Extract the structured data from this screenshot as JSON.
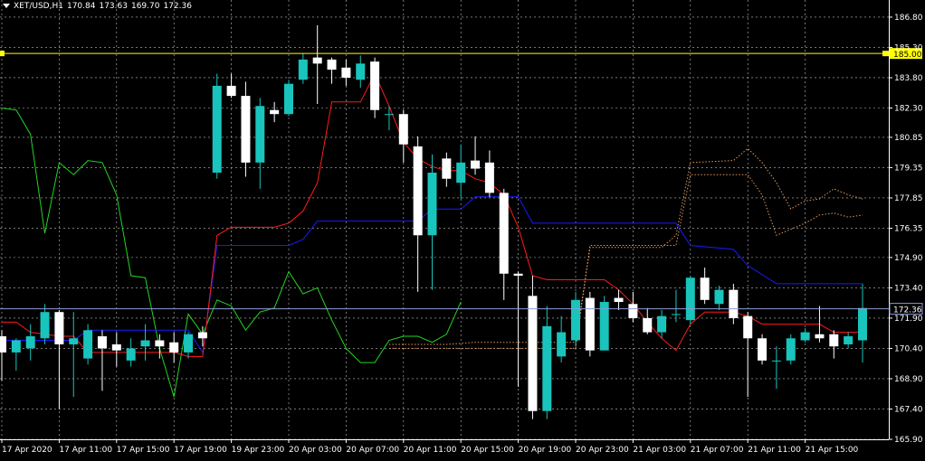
{
  "header": {
    "symbol": "XET/USD,H1",
    "open": "170.84",
    "high": "173.63",
    "low": "169.70",
    "close": "172.36"
  },
  "colors": {
    "background": "#000000",
    "grid": "#c0c0c0",
    "bull": "#19c4bd",
    "bear": "#ffffff",
    "tenkan": "#ff1a1a",
    "kijun": "#1a1aff",
    "chikou": "#22d422",
    "cloud": "#e0985a",
    "alert": "#ffff00",
    "price": "#8c9cd8"
  },
  "chart_data": {
    "type": "candlestick",
    "ylim": [
      165.9,
      187.2
    ],
    "y_ticks": [
      "186.80",
      "185.30",
      "183.80",
      "182.30",
      "180.85",
      "179.35",
      "177.85",
      "176.35",
      "174.90",
      "173.40",
      "171.90",
      "170.40",
      "168.90",
      "167.40",
      "165.90"
    ],
    "x_tick_labels": [
      "17 Apr 2020",
      "17 Apr 11:00",
      "17 Apr 15:00",
      "17 Apr 19:00",
      "19 Apr 23:00",
      "20 Apr 03:00",
      "20 Apr 07:00",
      "20 Apr 11:00",
      "20 Apr 15:00",
      "20 Apr 19:00",
      "20 Apr 23:00",
      "21 Apr 03:00",
      "21 Apr 07:00",
      "21 Apr 11:00",
      "21 Apr 15:00"
    ],
    "alert_level": "185.00",
    "current_price": "172.36",
    "candles": [
      {
        "o": 171.0,
        "h": 171.3,
        "l": 168.8,
        "c": 170.2
      },
      {
        "o": 170.2,
        "h": 170.9,
        "l": 169.3,
        "c": 170.8
      },
      {
        "o": 170.4,
        "h": 171.6,
        "l": 169.8,
        "c": 171.0
      },
      {
        "o": 170.9,
        "h": 172.6,
        "l": 170.6,
        "c": 172.2
      },
      {
        "o": 172.2,
        "h": 172.3,
        "l": 167.4,
        "c": 170.6
      },
      {
        "o": 170.6,
        "h": 172.2,
        "l": 168.0,
        "c": 170.9
      },
      {
        "o": 169.9,
        "h": 171.6,
        "l": 169.6,
        "c": 171.3
      },
      {
        "o": 171.0,
        "h": 171.3,
        "l": 168.3,
        "c": 170.4
      },
      {
        "o": 170.6,
        "h": 171.2,
        "l": 169.5,
        "c": 170.3
      },
      {
        "o": 169.8,
        "h": 170.9,
        "l": 169.5,
        "c": 170.4
      },
      {
        "o": 170.5,
        "h": 171.6,
        "l": 169.8,
        "c": 170.8
      },
      {
        "o": 170.8,
        "h": 171.1,
        "l": 169.9,
        "c": 170.5
      },
      {
        "o": 170.7,
        "h": 171.2,
        "l": 169.7,
        "c": 170.2
      },
      {
        "o": 170.2,
        "h": 171.2,
        "l": 169.9,
        "c": 171.1
      },
      {
        "o": 171.2,
        "h": 171.5,
        "l": 170.5,
        "c": 170.9
      },
      {
        "o": 179.1,
        "h": 184.0,
        "l": 178.8,
        "c": 183.4
      },
      {
        "o": 183.4,
        "h": 184.0,
        "l": 182.8,
        "c": 182.9
      },
      {
        "o": 182.9,
        "h": 183.6,
        "l": 178.9,
        "c": 179.6
      },
      {
        "o": 179.6,
        "h": 182.8,
        "l": 178.3,
        "c": 182.4
      },
      {
        "o": 182.2,
        "h": 182.6,
        "l": 181.6,
        "c": 182.0
      },
      {
        "o": 182.0,
        "h": 183.7,
        "l": 181.9,
        "c": 183.5
      },
      {
        "o": 183.7,
        "h": 185.0,
        "l": 183.5,
        "c": 184.7
      },
      {
        "o": 184.8,
        "h": 186.4,
        "l": 182.5,
        "c": 184.5
      },
      {
        "o": 184.7,
        "h": 184.8,
        "l": 183.5,
        "c": 184.2
      },
      {
        "o": 184.3,
        "h": 184.7,
        "l": 183.4,
        "c": 183.8
      },
      {
        "o": 183.7,
        "h": 184.9,
        "l": 183.3,
        "c": 184.5
      },
      {
        "o": 184.6,
        "h": 184.8,
        "l": 181.8,
        "c": 182.2
      },
      {
        "o": 182.0,
        "h": 182.4,
        "l": 181.2,
        "c": 182.0
      },
      {
        "o": 182.0,
        "h": 182.2,
        "l": 179.6,
        "c": 180.5
      },
      {
        "o": 180.4,
        "h": 180.9,
        "l": 173.2,
        "c": 176.0
      },
      {
        "o": 176.0,
        "h": 180.0,
        "l": 173.3,
        "c": 179.1
      },
      {
        "o": 179.8,
        "h": 180.1,
        "l": 178.4,
        "c": 178.8
      },
      {
        "o": 178.6,
        "h": 180.5,
        "l": 177.8,
        "c": 179.6
      },
      {
        "o": 179.7,
        "h": 180.9,
        "l": 179.0,
        "c": 179.3
      },
      {
        "o": 179.6,
        "h": 180.2,
        "l": 177.9,
        "c": 178.1
      },
      {
        "o": 178.1,
        "h": 178.3,
        "l": 172.8,
        "c": 174.1
      },
      {
        "o": 174.1,
        "h": 174.2,
        "l": 168.5,
        "c": 174.0
      },
      {
        "o": 173.0,
        "h": 174.0,
        "l": 166.9,
        "c": 167.3
      },
      {
        "o": 167.3,
        "h": 172.5,
        "l": 166.9,
        "c": 171.5
      },
      {
        "o": 170.0,
        "h": 172.0,
        "l": 169.7,
        "c": 171.2
      },
      {
        "o": 170.8,
        "h": 173.2,
        "l": 170.5,
        "c": 172.8
      },
      {
        "o": 172.9,
        "h": 173.2,
        "l": 170.0,
        "c": 170.3
      },
      {
        "o": 170.3,
        "h": 173.0,
        "l": 170.3,
        "c": 172.7
      },
      {
        "o": 172.9,
        "h": 173.3,
        "l": 172.3,
        "c": 172.7
      },
      {
        "o": 172.6,
        "h": 173.2,
        "l": 171.7,
        "c": 171.9
      },
      {
        "o": 171.9,
        "h": 172.4,
        "l": 171.1,
        "c": 171.2
      },
      {
        "o": 171.2,
        "h": 172.3,
        "l": 170.9,
        "c": 172.0
      },
      {
        "o": 172.1,
        "h": 173.3,
        "l": 171.7,
        "c": 172.1
      },
      {
        "o": 171.8,
        "h": 174.0,
        "l": 171.6,
        "c": 173.9
      },
      {
        "o": 173.9,
        "h": 174.4,
        "l": 172.6,
        "c": 172.8
      },
      {
        "o": 172.6,
        "h": 173.5,
        "l": 172.3,
        "c": 173.3
      },
      {
        "o": 173.3,
        "h": 173.6,
        "l": 171.6,
        "c": 171.9
      },
      {
        "o": 172.0,
        "h": 172.2,
        "l": 168.0,
        "c": 170.9
      },
      {
        "o": 170.9,
        "h": 171.1,
        "l": 169.6,
        "c": 169.8
      },
      {
        "o": 169.8,
        "h": 170.5,
        "l": 168.4,
        "c": 169.8
      },
      {
        "o": 169.8,
        "h": 171.1,
        "l": 169.6,
        "c": 170.9
      },
      {
        "o": 170.8,
        "h": 171.4,
        "l": 170.7,
        "c": 171.2
      },
      {
        "o": 171.1,
        "h": 172.5,
        "l": 170.7,
        "c": 170.9
      },
      {
        "o": 171.1,
        "h": 171.3,
        "l": 169.9,
        "c": 170.5
      },
      {
        "o": 170.6,
        "h": 171.2,
        "l": 170.4,
        "c": 171.0
      },
      {
        "o": 170.8,
        "h": 173.6,
        "l": 169.7,
        "c": 172.4
      }
    ],
    "tenkan_sen": [
      {
        "i": 0,
        "v": 171.7
      },
      {
        "i": 1,
        "v": 171.7
      },
      {
        "i": 2,
        "v": 171.2
      },
      {
        "i": 3,
        "v": 171.1
      },
      {
        "i": 4,
        "v": 171.0
      },
      {
        "i": 5,
        "v": 171.0
      },
      {
        "i": 6,
        "v": 170.2
      },
      {
        "i": 7,
        "v": 170.2
      },
      {
        "i": 8,
        "v": 170.2
      },
      {
        "i": 9,
        "v": 170.2
      },
      {
        "i": 10,
        "v": 170.2
      },
      {
        "i": 11,
        "v": 170.2
      },
      {
        "i": 12,
        "v": 170.2
      },
      {
        "i": 13,
        "v": 170.0
      },
      {
        "i": 14,
        "v": 170.0
      },
      {
        "i": 15,
        "v": 176.0
      },
      {
        "i": 16,
        "v": 176.4
      },
      {
        "i": 17,
        "v": 176.4
      },
      {
        "i": 18,
        "v": 176.4
      },
      {
        "i": 19,
        "v": 176.4
      },
      {
        "i": 20,
        "v": 176.6
      },
      {
        "i": 21,
        "v": 177.2
      },
      {
        "i": 22,
        "v": 178.6
      },
      {
        "i": 23,
        "v": 182.6
      },
      {
        "i": 24,
        "v": 182.6
      },
      {
        "i": 25,
        "v": 182.6
      },
      {
        "i": 26,
        "v": 184.0
      },
      {
        "i": 27,
        "v": 182.4
      },
      {
        "i": 28,
        "v": 180.6
      },
      {
        "i": 29,
        "v": 179.8
      },
      {
        "i": 30,
        "v": 179.4
      },
      {
        "i": 31,
        "v": 179.2
      },
      {
        "i": 32,
        "v": 179.2
      },
      {
        "i": 33,
        "v": 178.8
      },
      {
        "i": 34,
        "v": 178.6
      },
      {
        "i": 35,
        "v": 178.0
      },
      {
        "i": 36,
        "v": 176.4
      },
      {
        "i": 37,
        "v": 174.0
      },
      {
        "i": 38,
        "v": 173.8
      },
      {
        "i": 39,
        "v": 173.8
      },
      {
        "i": 40,
        "v": 173.8
      },
      {
        "i": 41,
        "v": 173.8
      },
      {
        "i": 42,
        "v": 173.8
      },
      {
        "i": 43,
        "v": 173.3
      },
      {
        "i": 44,
        "v": 172.6
      },
      {
        "i": 45,
        "v": 171.7
      },
      {
        "i": 46,
        "v": 170.9
      },
      {
        "i": 47,
        "v": 170.3
      },
      {
        "i": 48,
        "v": 171.6
      },
      {
        "i": 49,
        "v": 172.2
      },
      {
        "i": 50,
        "v": 172.2
      },
      {
        "i": 51,
        "v": 172.2
      },
      {
        "i": 52,
        "v": 172.0
      },
      {
        "i": 53,
        "v": 171.6
      },
      {
        "i": 54,
        "v": 171.6
      },
      {
        "i": 55,
        "v": 171.6
      },
      {
        "i": 56,
        "v": 171.6
      },
      {
        "i": 57,
        "v": 171.6
      },
      {
        "i": 58,
        "v": 171.2
      },
      {
        "i": 59,
        "v": 171.2
      },
      {
        "i": 60,
        "v": 171.2
      }
    ],
    "kijun_sen": [
      {
        "i": 0,
        "v": 170.8
      },
      {
        "i": 5,
        "v": 170.8
      },
      {
        "i": 6,
        "v": 171.3
      },
      {
        "i": 13,
        "v": 171.3
      },
      {
        "i": 14,
        "v": 170.2
      },
      {
        "i": 15,
        "v": 175.5
      },
      {
        "i": 20,
        "v": 175.5
      },
      {
        "i": 21,
        "v": 175.8
      },
      {
        "i": 22,
        "v": 176.7
      },
      {
        "i": 29,
        "v": 176.7
      },
      {
        "i": 30,
        "v": 177.3
      },
      {
        "i": 32,
        "v": 177.3
      },
      {
        "i": 33,
        "v": 177.9
      },
      {
        "i": 36,
        "v": 177.9
      },
      {
        "i": 37,
        "v": 176.6
      },
      {
        "i": 47,
        "v": 176.6
      },
      {
        "i": 48,
        "v": 175.5
      },
      {
        "i": 51,
        "v": 175.3
      },
      {
        "i": 52,
        "v": 174.5
      },
      {
        "i": 54,
        "v": 173.6
      },
      {
        "i": 60,
        "v": 173.6
      }
    ],
    "chikou_span": [
      {
        "i": 0,
        "v": 182.3
      },
      {
        "i": 1,
        "v": 182.2
      },
      {
        "i": 2,
        "v": 181.0
      },
      {
        "i": 3,
        "v": 176.1
      },
      {
        "i": 4,
        "v": 179.6
      },
      {
        "i": 5,
        "v": 179.0
      },
      {
        "i": 6,
        "v": 179.7
      },
      {
        "i": 7,
        "v": 179.6
      },
      {
        "i": 8,
        "v": 178.0
      },
      {
        "i": 9,
        "v": 174.0
      },
      {
        "i": 10,
        "v": 173.9
      },
      {
        "i": 11,
        "v": 170.4
      },
      {
        "i": 12,
        "v": 168.0
      },
      {
        "i": 13,
        "v": 172.1
      },
      {
        "i": 14,
        "v": 171.1
      },
      {
        "i": 15,
        "v": 172.8
      },
      {
        "i": 16,
        "v": 172.5
      },
      {
        "i": 17,
        "v": 171.3
      },
      {
        "i": 18,
        "v": 172.2
      },
      {
        "i": 19,
        "v": 172.4
      },
      {
        "i": 20,
        "v": 174.2
      },
      {
        "i": 21,
        "v": 173.1
      },
      {
        "i": 22,
        "v": 173.4
      },
      {
        "i": 23,
        "v": 171.8
      },
      {
        "i": 24,
        "v": 170.4
      },
      {
        "i": 25,
        "v": 169.7
      },
      {
        "i": 26,
        "v": 169.7
      },
      {
        "i": 27,
        "v": 170.8
      },
      {
        "i": 28,
        "v": 171.0
      },
      {
        "i": 29,
        "v": 171.0
      },
      {
        "i": 30,
        "v": 170.7
      },
      {
        "i": 31,
        "v": 171.1
      },
      {
        "i": 32,
        "v": 172.7
      }
    ],
    "senkou_span_a": [
      {
        "i": 27,
        "v": 170.6
      },
      {
        "i": 31,
        "v": 170.6
      },
      {
        "i": 33,
        "v": 170.7
      },
      {
        "i": 40,
        "v": 170.7
      },
      {
        "i": 41,
        "v": 175.4
      },
      {
        "i": 46,
        "v": 175.4
      },
      {
        "i": 47,
        "v": 176.0
      },
      {
        "i": 48,
        "v": 179.6
      },
      {
        "i": 51,
        "v": 179.7
      },
      {
        "i": 52,
        "v": 180.3
      },
      {
        "i": 53,
        "v": 179.6
      },
      {
        "i": 54,
        "v": 178.6
      },
      {
        "i": 55,
        "v": 177.3
      },
      {
        "i": 56,
        "v": 177.7
      },
      {
        "i": 57,
        "v": 177.8
      },
      {
        "i": 58,
        "v": 178.3
      },
      {
        "i": 59,
        "v": 178.0
      },
      {
        "i": 60,
        "v": 177.8
      }
    ],
    "senkou_span_b": [
      {
        "i": 27,
        "v": 170.4
      },
      {
        "i": 40,
        "v": 170.4
      },
      {
        "i": 41,
        "v": 175.5
      },
      {
        "i": 47,
        "v": 175.5
      },
      {
        "i": 48,
        "v": 179.0
      },
      {
        "i": 52,
        "v": 179.0
      },
      {
        "i": 53,
        "v": 178.0
      },
      {
        "i": 54,
        "v": 176.0
      },
      {
        "i": 55,
        "v": 176.3
      },
      {
        "i": 56,
        "v": 176.6
      },
      {
        "i": 57,
        "v": 177.0
      },
      {
        "i": 58,
        "v": 177.1
      },
      {
        "i": 59,
        "v": 176.9
      },
      {
        "i": 60,
        "v": 177.0
      }
    ]
  }
}
